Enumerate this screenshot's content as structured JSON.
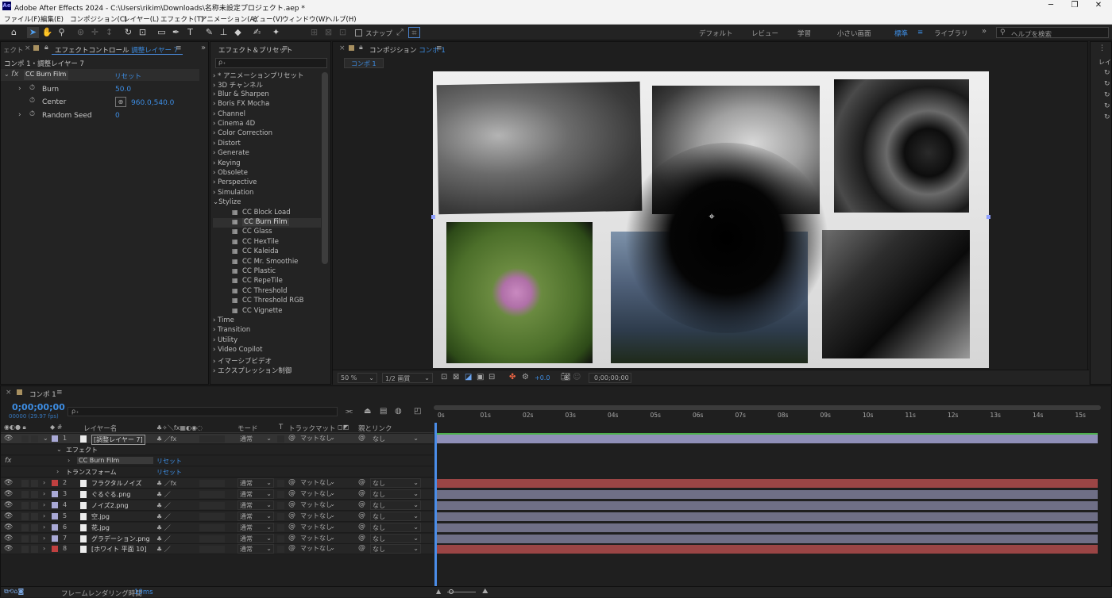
{
  "window": {
    "title": "Adobe After Effects 2024 - C:\\Users\\rikim\\Downloads\\名称未設定プロジェクト.aep *",
    "app_badge": "Ae",
    "minimize": "─",
    "maximize": "❐",
    "close": "✕"
  },
  "menu": [
    "ファイル(F)",
    "編集(E)",
    "コンポジション(C)",
    "レイヤー(L)",
    "エフェクト(T)",
    "アニメーション(A)",
    "ビュー(V)",
    "ウィンドウ(W)",
    "ヘルプ(H)"
  ],
  "toolbar": {
    "snap_label": "スナップ",
    "workspaces": [
      "デフォルト",
      "レビュー",
      "学習",
      "小さい画面",
      "標準",
      "ライブラリ"
    ],
    "active_workspace": "標準",
    "search_placeholder": "ヘルプを検索",
    "overflow": "»"
  },
  "effect_controls": {
    "left_stub": "ェクト",
    "tab": "エフェクトコントロール",
    "tab_layer": "調整レイヤー 7",
    "breadcrumb": "コンポ 1・調整レイヤー 7",
    "effect_name": "CC Burn Film",
    "reset": "リセット",
    "params": [
      {
        "name": "Burn",
        "value": "50.0"
      },
      {
        "name": "Center",
        "value": "960.0,540.0"
      },
      {
        "name": "Random Seed",
        "value": "0"
      }
    ]
  },
  "effects_presets": {
    "tab": "エフェクト＆プリセット",
    "search_placeholder": "ρ₊",
    "categories_top": [
      "* アニメーションプリセット",
      "3D チャンネル",
      "Blur & Sharpen",
      "Boris FX Mocha",
      "Channel",
      "Cinema 4D",
      "Color Correction",
      "Distort",
      "Generate",
      "Keying",
      "Obsolete",
      "Perspective",
      "Simulation"
    ],
    "open_category": "Stylize",
    "stylize_items": [
      "CC Block Load",
      "CC Burn Film",
      "CC Glass",
      "CC HexTile",
      "CC Kaleida",
      "CC Mr. Smoothie",
      "CC Plastic",
      "CC RepeTile",
      "CC Threshold",
      "CC Threshold RGB",
      "CC Vignette"
    ],
    "selected_item": "CC Burn Film",
    "categories_bottom": [
      "Time",
      "Transition",
      "Utility",
      "Video Copilot",
      "イマーシブビデオ",
      "エクスプレッション制御"
    ]
  },
  "composition": {
    "tab_prefix": "コンポジション",
    "tab_name": "コンポ 1",
    "sub_tab": "コンポ 1",
    "zoom": "50 %",
    "resolution": "1/2 画質",
    "exposure": "+0.0",
    "timecode": "0;00;00;00"
  },
  "right_panel": {
    "label": "レイ"
  },
  "timeline": {
    "tab": "コンポ 1",
    "timecode": "0;00;00;00",
    "fps": "00000 (29.97 fps)",
    "search_placeholder": "ρ₊",
    "headers": {
      "layer_name": "レイヤー名",
      "mode": "モード",
      "trackmatte": "トラックマット",
      "parent": "親とリンク",
      "t": "T"
    },
    "ruler": [
      "0s",
      "01s",
      "02s",
      "03s",
      "04s",
      "05s",
      "06s",
      "07s",
      "08s",
      "09s",
      "10s",
      "11s",
      "12s",
      "13s",
      "14s",
      "15s"
    ],
    "effect_group": "エフェクト",
    "effect_name": "CC Burn Film",
    "transform": "トランスフォーム",
    "reset": "リセット",
    "layers": [
      {
        "num": "1",
        "name": "[調整レイヤー 7]",
        "color": "#a9a9d6",
        "mode": "通常",
        "matte": "マットなし",
        "parent": "なし",
        "bar": "#8f8fb8"
      },
      {
        "num": "2",
        "name": "フラクタルノイズ",
        "color": "#c04040",
        "mode": "通常",
        "matte": "マットなし",
        "parent": "なし",
        "bar": "#9b4545"
      },
      {
        "num": "3",
        "name": "ぐるぐる.png",
        "color": "#a9a9d6",
        "mode": "通常",
        "matte": "マットなし",
        "parent": "なし",
        "bar": "#6f6f86"
      },
      {
        "num": "4",
        "name": "ノイズ2.png",
        "color": "#a9a9d6",
        "mode": "通常",
        "matte": "マットなし",
        "parent": "なし",
        "bar": "#6f6f86"
      },
      {
        "num": "5",
        "name": "空.jpg",
        "color": "#a9a9d6",
        "mode": "通常",
        "matte": "マットなし",
        "parent": "なし",
        "bar": "#6f6f86"
      },
      {
        "num": "6",
        "name": "花.jpg",
        "color": "#a9a9d6",
        "mode": "通常",
        "matte": "マットなし",
        "parent": "なし",
        "bar": "#6f6f86"
      },
      {
        "num": "7",
        "name": "グラデーション.png",
        "color": "#a9a9d6",
        "mode": "通常",
        "matte": "マットなし",
        "parent": "なし",
        "bar": "#6f6f86"
      },
      {
        "num": "8",
        "name": "[ホワイト 平面 10]",
        "color": "#c04040",
        "mode": "通常",
        "matte": "マットなし",
        "parent": "なし",
        "bar": "#9b4545"
      }
    ],
    "footer": "フレームレンダリング時間",
    "render_time": "10ms"
  }
}
